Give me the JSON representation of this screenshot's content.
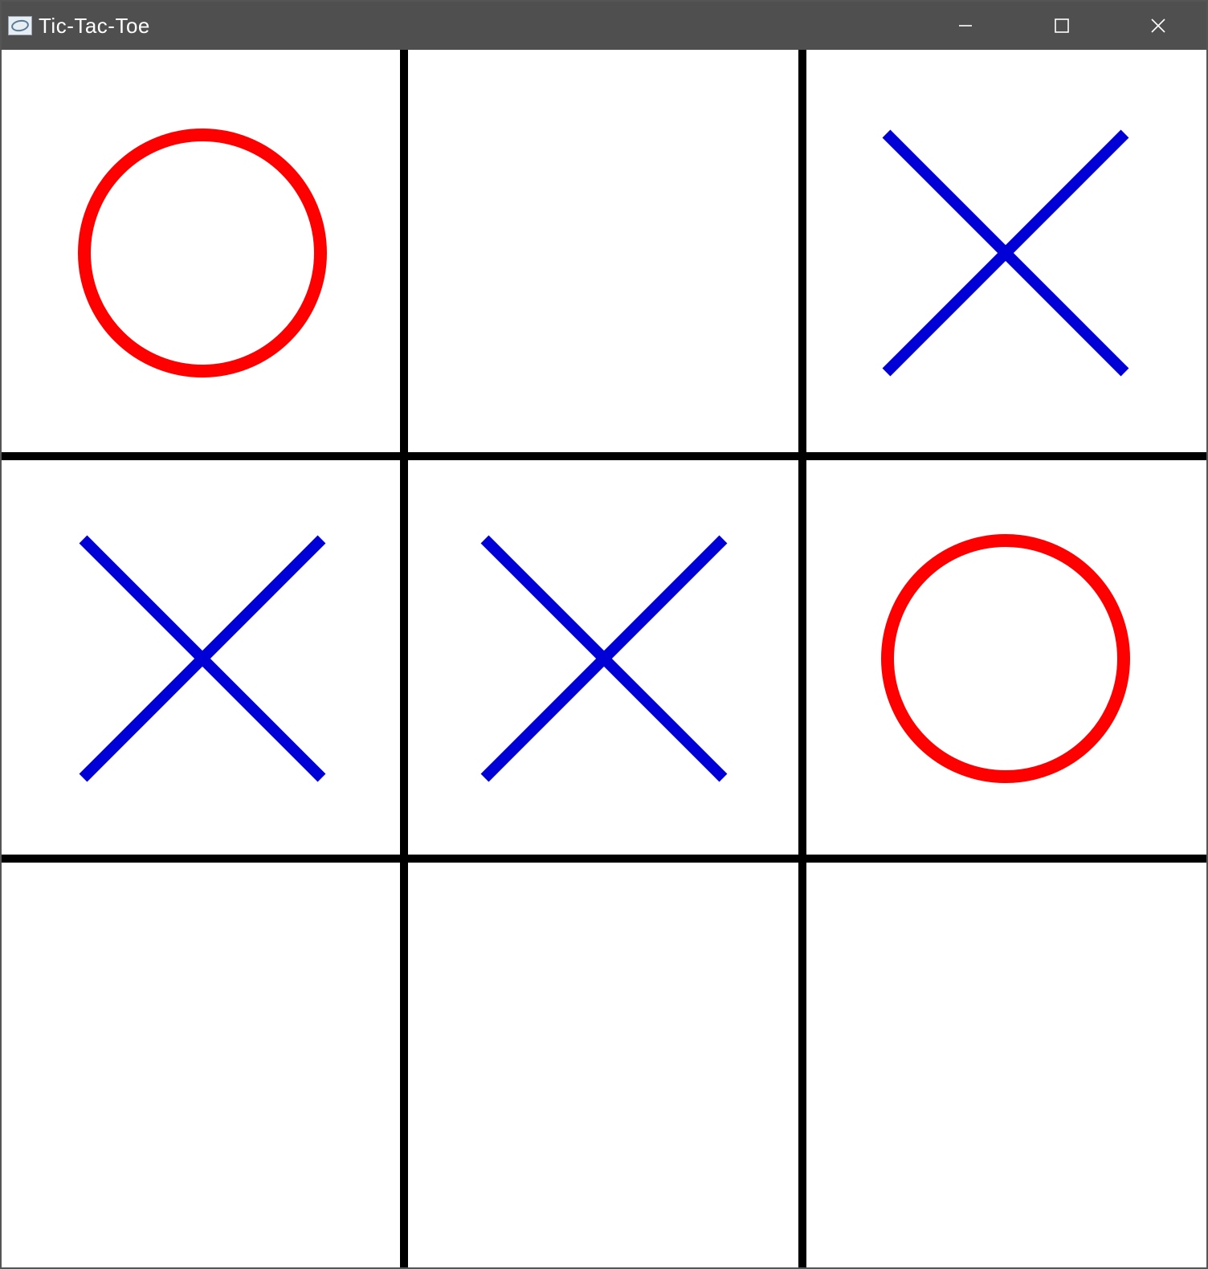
{
  "window": {
    "title": "Tic-Tac-Toe"
  },
  "colors": {
    "x": "#0000d6",
    "o": "#ff0000",
    "grid": "#000000",
    "titlebar": "#4f4f4f"
  },
  "game": {
    "board": [
      [
        "O",
        "",
        "X"
      ],
      [
        "X",
        "X",
        "O"
      ],
      [
        "",
        "",
        ""
      ]
    ],
    "rows": 3,
    "cols": 3
  }
}
